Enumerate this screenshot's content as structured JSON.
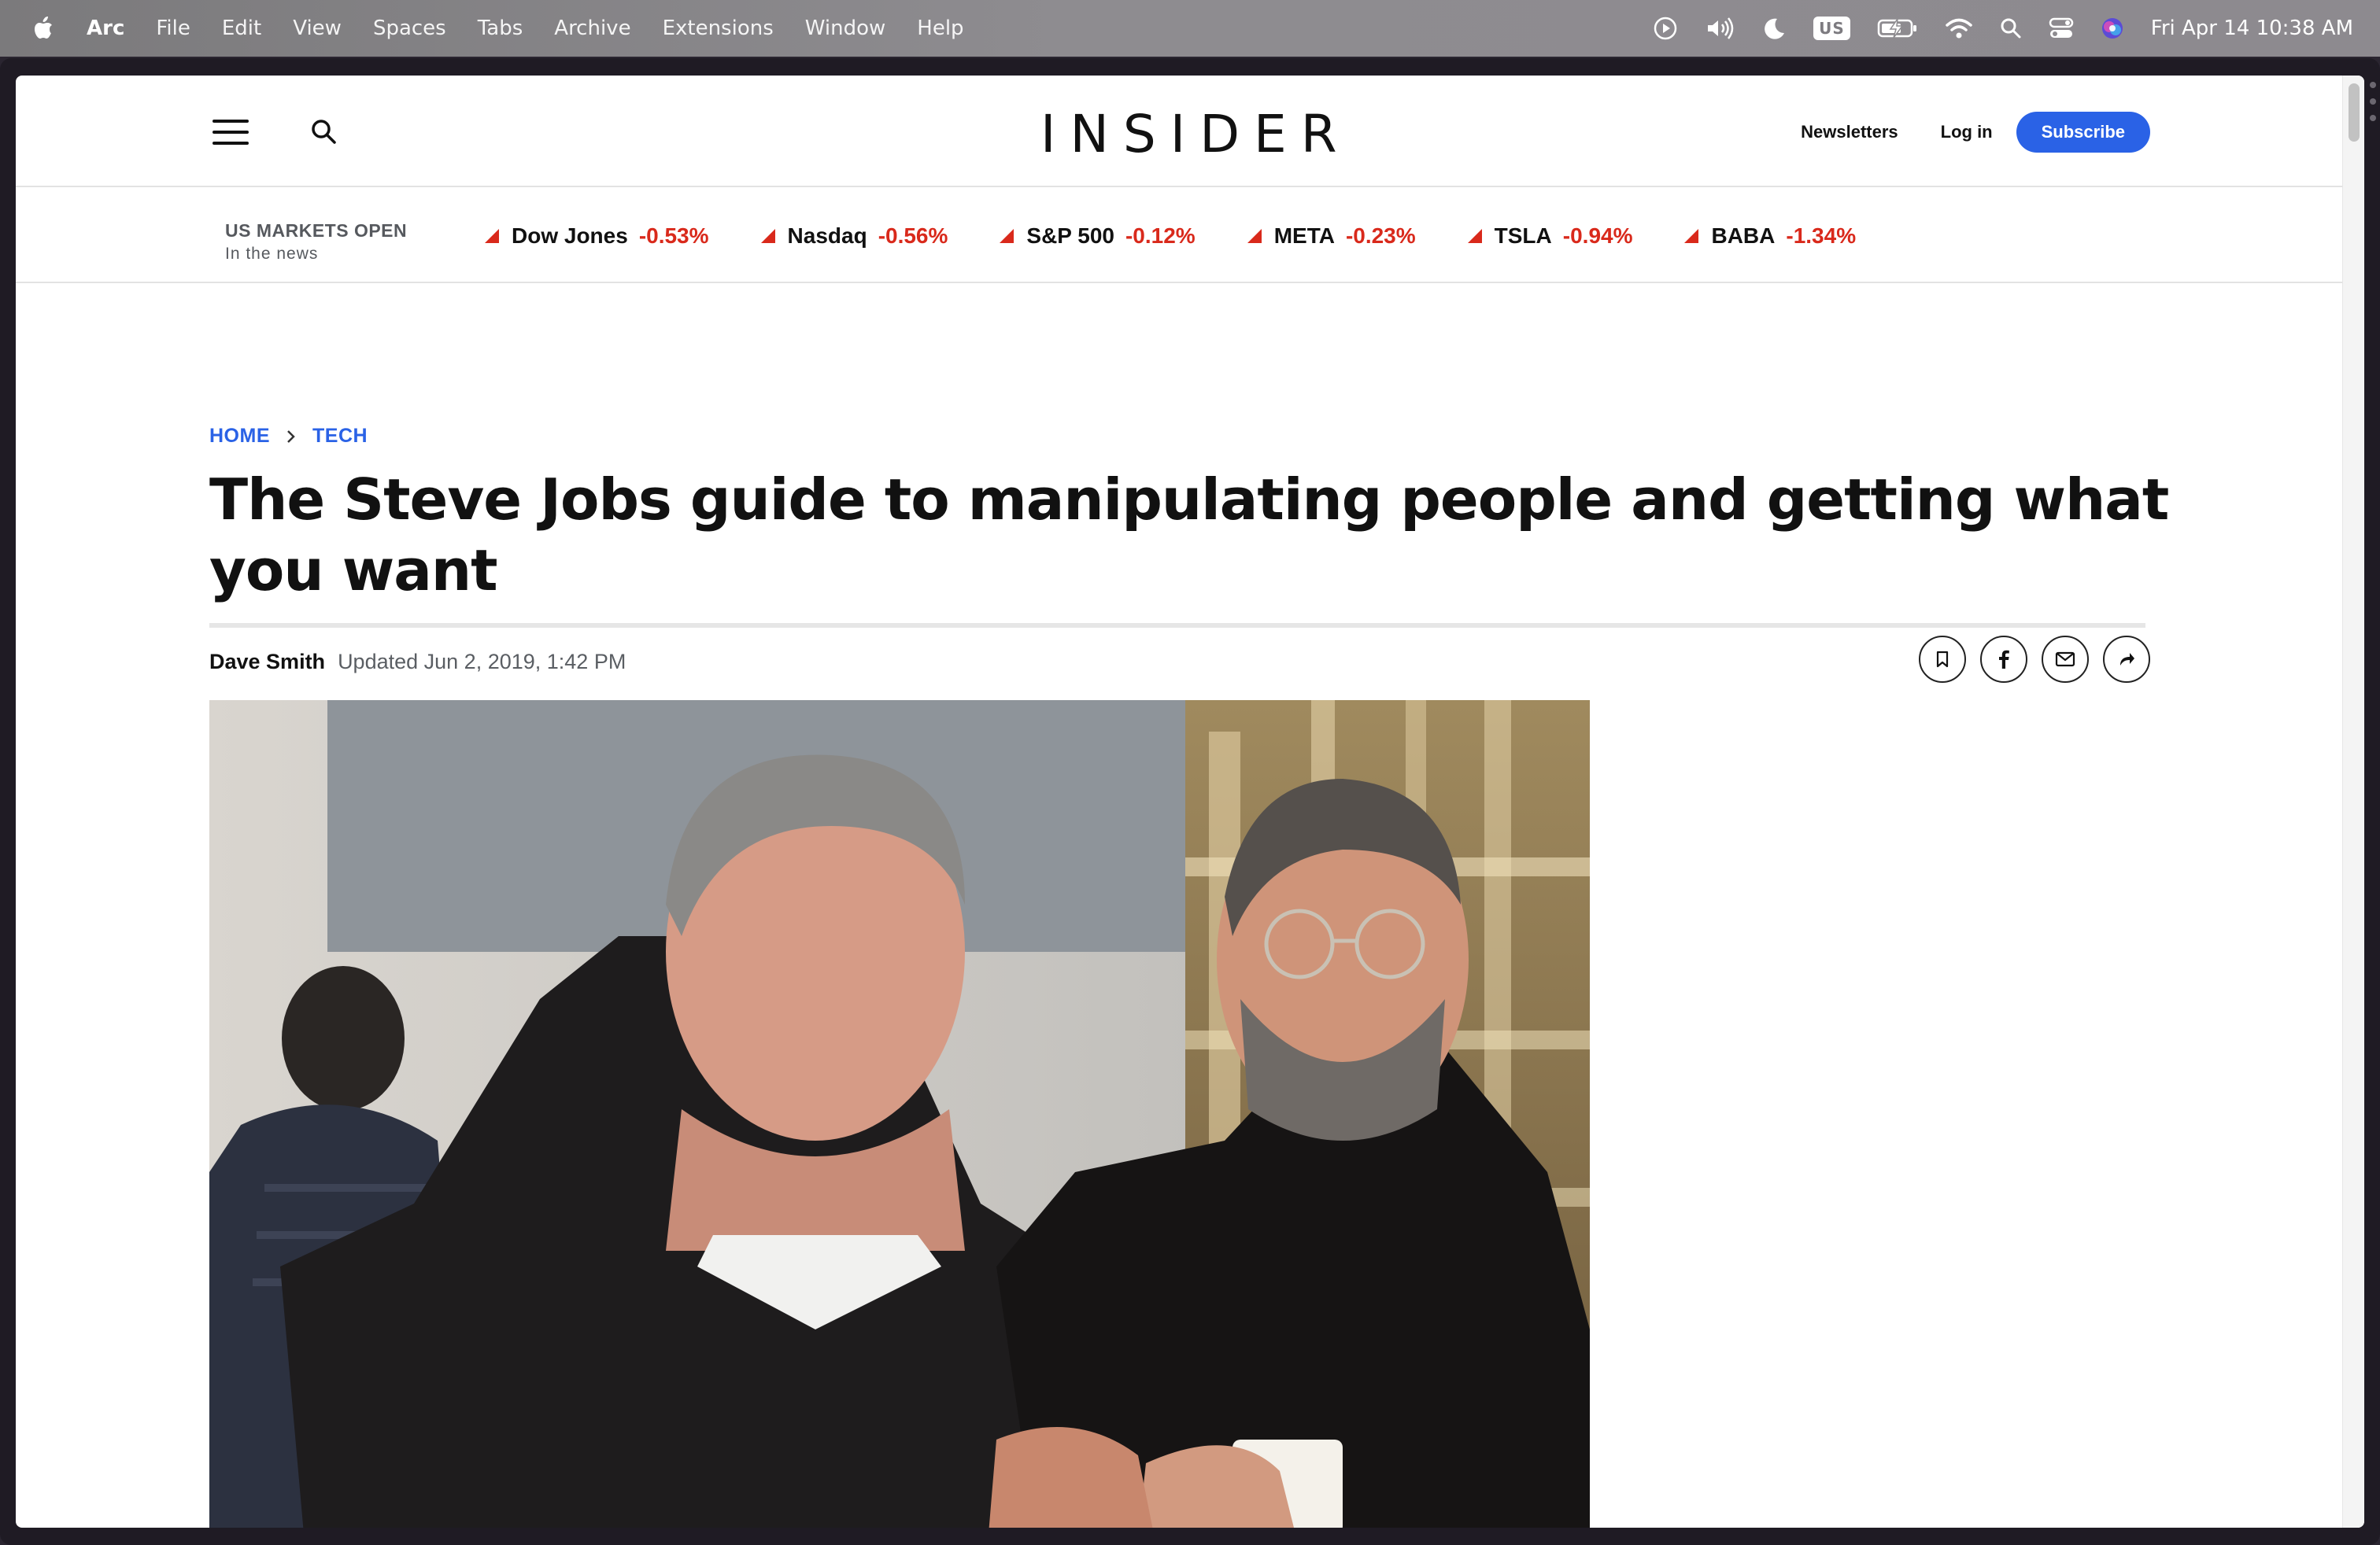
{
  "menubar": {
    "app_name": "Arc",
    "items": [
      "File",
      "Edit",
      "View",
      "Spaces",
      "Tabs",
      "Archive",
      "Extensions",
      "Window",
      "Help"
    ],
    "keyboard_layout": "US",
    "clock": "Fri Apr 14  10:38 AM"
  },
  "site": {
    "logo": "INSIDER",
    "newsletters": "Newsletters",
    "login": "Log in",
    "subscribe": "Subscribe"
  },
  "markets": {
    "status": "US MARKETS OPEN",
    "subtitle": "In the news",
    "down_color": "#d9291b",
    "tickers": [
      {
        "name": "Dow Jones",
        "change": "-0.53%"
      },
      {
        "name": "Nasdaq",
        "change": "-0.56%"
      },
      {
        "name": "S&P 500",
        "change": "-0.12%"
      },
      {
        "name": "META",
        "change": "-0.23%"
      },
      {
        "name": "TSLA",
        "change": "-0.94%"
      },
      {
        "name": "BABA",
        "change": "-1.34%"
      }
    ]
  },
  "article": {
    "breadcrumb": [
      "HOME",
      "TECH"
    ],
    "headline": "The Steve Jobs guide to manipulating people and getting what you want",
    "author": "Dave Smith",
    "updated": "Updated Jun 2, 2019, 1:42 PM",
    "share_icons": [
      "bookmark-icon",
      "facebook-icon",
      "email-icon",
      "share-icon"
    ]
  },
  "theme": {
    "accent": "#2a62e6",
    "text": "#111111"
  }
}
